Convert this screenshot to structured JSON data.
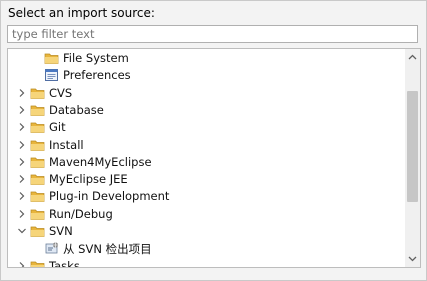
{
  "prompt": "Select an import source:",
  "filter": {
    "placeholder": "type filter text",
    "value": ""
  },
  "tree": {
    "items": [
      {
        "label": "File System",
        "level": 2,
        "icon": "folder-icon",
        "expander": "none"
      },
      {
        "label": "Preferences",
        "level": 2,
        "icon": "preferences-icon",
        "expander": "none"
      },
      {
        "label": "CVS",
        "level": 1,
        "icon": "folder-icon",
        "expander": "collapsed"
      },
      {
        "label": "Database",
        "level": 1,
        "icon": "folder-icon",
        "expander": "collapsed"
      },
      {
        "label": "Git",
        "level": 1,
        "icon": "folder-icon",
        "expander": "collapsed"
      },
      {
        "label": "Install",
        "level": 1,
        "icon": "folder-icon",
        "expander": "collapsed"
      },
      {
        "label": "Maven4MyEclipse",
        "level": 1,
        "icon": "folder-icon",
        "expander": "collapsed"
      },
      {
        "label": "MyEclipse JEE",
        "level": 1,
        "icon": "folder-icon",
        "expander": "collapsed"
      },
      {
        "label": "Plug-in Development",
        "level": 1,
        "icon": "folder-icon",
        "expander": "collapsed"
      },
      {
        "label": "Run/Debug",
        "level": 1,
        "icon": "folder-icon",
        "expander": "collapsed"
      },
      {
        "label": "SVN",
        "level": 1,
        "icon": "folder-icon",
        "expander": "expanded"
      },
      {
        "label": "从 SVN 检出项目",
        "level": 2,
        "icon": "svn-checkout-icon",
        "expander": "none"
      },
      {
        "label": "Tasks",
        "level": 1,
        "icon": "folder-icon",
        "expander": "collapsed"
      }
    ]
  },
  "colors": {
    "folder": "#e8b53d",
    "folder_light": "#f6d57a",
    "chevron": "#5a5a5a"
  }
}
